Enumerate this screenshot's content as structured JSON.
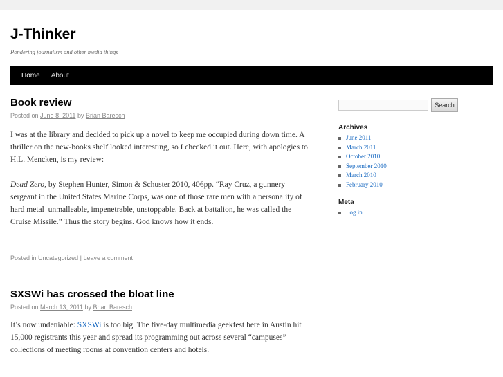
{
  "site": {
    "title": "J-Thinker",
    "description": "Pondering journalism and other media things"
  },
  "nav": {
    "items": [
      {
        "label": "Home"
      },
      {
        "label": "About"
      }
    ]
  },
  "posts": [
    {
      "title": "Book review",
      "posted_on": "Posted on",
      "date": "June 8, 2011",
      "by": "by",
      "author": "Brian Baresch",
      "para1": "I was at the library and decided to pick up a novel to keep me occupied during down time. A thriller on the new-books shelf looked interesting, so I checked it out. Here, with apologies to H.L. Mencken, is my review:",
      "book_title": "Dead Zero,",
      "para2_rest": " by Stephen Hunter, Simon & Schuster 2010, 406pp. “Ray Cruz, a gunnery sergeant in the United States Marine Corps, was one of those rare men with a personality of hard metal–unmalleable, impenetrable, unstoppable. Back at battalion, he was called the Cruise Missile.” Thus the story begins. God knows how it ends.",
      "posted_in": "Posted in",
      "category": "Uncategorized",
      "separator": "|",
      "comment_link": "Leave a comment"
    },
    {
      "title": "SXSWi has crossed the bloat line",
      "posted_on": "Posted on",
      "date": "March 13, 2011",
      "by": "by",
      "author": "Brian Baresch",
      "para1_pre": "It’s now undeniable: ",
      "para1_link": "SXSWi",
      "para1_post": " is too big. The five-day multimedia geekfest here in Austin hit 15,000 registrants this year and spread its programming out across several “campuses” — collections of meeting rooms at convention centers and hotels."
    }
  ],
  "sidebar": {
    "search": {
      "value": "",
      "button_label": "Search"
    },
    "archives": {
      "title": "Archives",
      "items": [
        "June 2011",
        "March 2011",
        "October 2010",
        "September 2010",
        "March 2010",
        "February 2010"
      ]
    },
    "meta": {
      "title": "Meta",
      "items": [
        "Log in"
      ]
    }
  }
}
